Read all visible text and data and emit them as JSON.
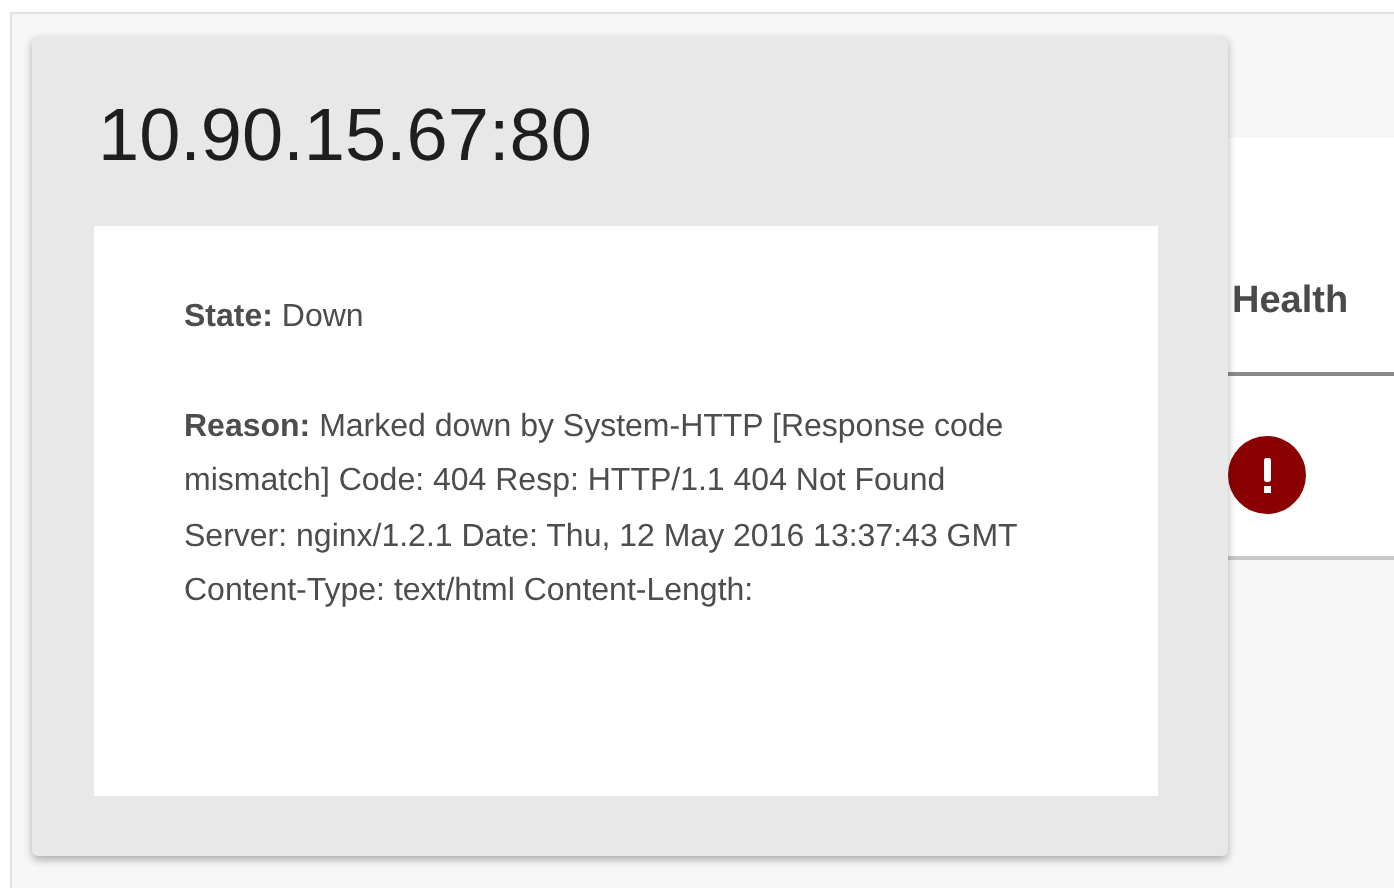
{
  "popover": {
    "title": "10.90.15.67:80",
    "state": "**State:** Down",
    "reason": "**Reason:** Marked down by System-HTTP [Response code mismatch] Code: 404 Resp: HTTP/1.1 404 Not Found Server: nginx/1.2.1 Date: Thu, 12 May 2016 13:37:43 GMT Content-Type: text/html Content-Length:"
  },
  "table": {
    "columns": [
      "Health"
    ],
    "rows": [
      {
        "kind": "error"
      }
    ]
  }
}
